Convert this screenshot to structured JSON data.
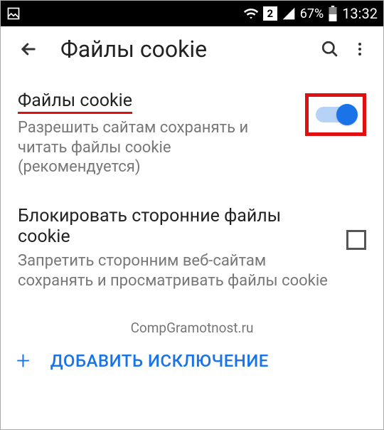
{
  "status": {
    "sim": "2",
    "battery": "67%",
    "time": "13:32"
  },
  "toolbar": {
    "title": "Файлы cookie"
  },
  "settings": {
    "cookies": {
      "title": "Файлы cookie",
      "desc": "Разрешить сайтам сохранять и читать файлы cookie (рекомендуется)"
    },
    "block_third": {
      "title": "Блокировать сторонние файлы cookie",
      "desc": "Запретить сторонним веб-сайтам сохранять и просматривать файлы cookie"
    }
  },
  "watermark": "CompGramotnost.ru",
  "add": {
    "plus": "+",
    "label": "ДОБАВИТЬ ИСКЛЮЧЕНИЕ"
  }
}
